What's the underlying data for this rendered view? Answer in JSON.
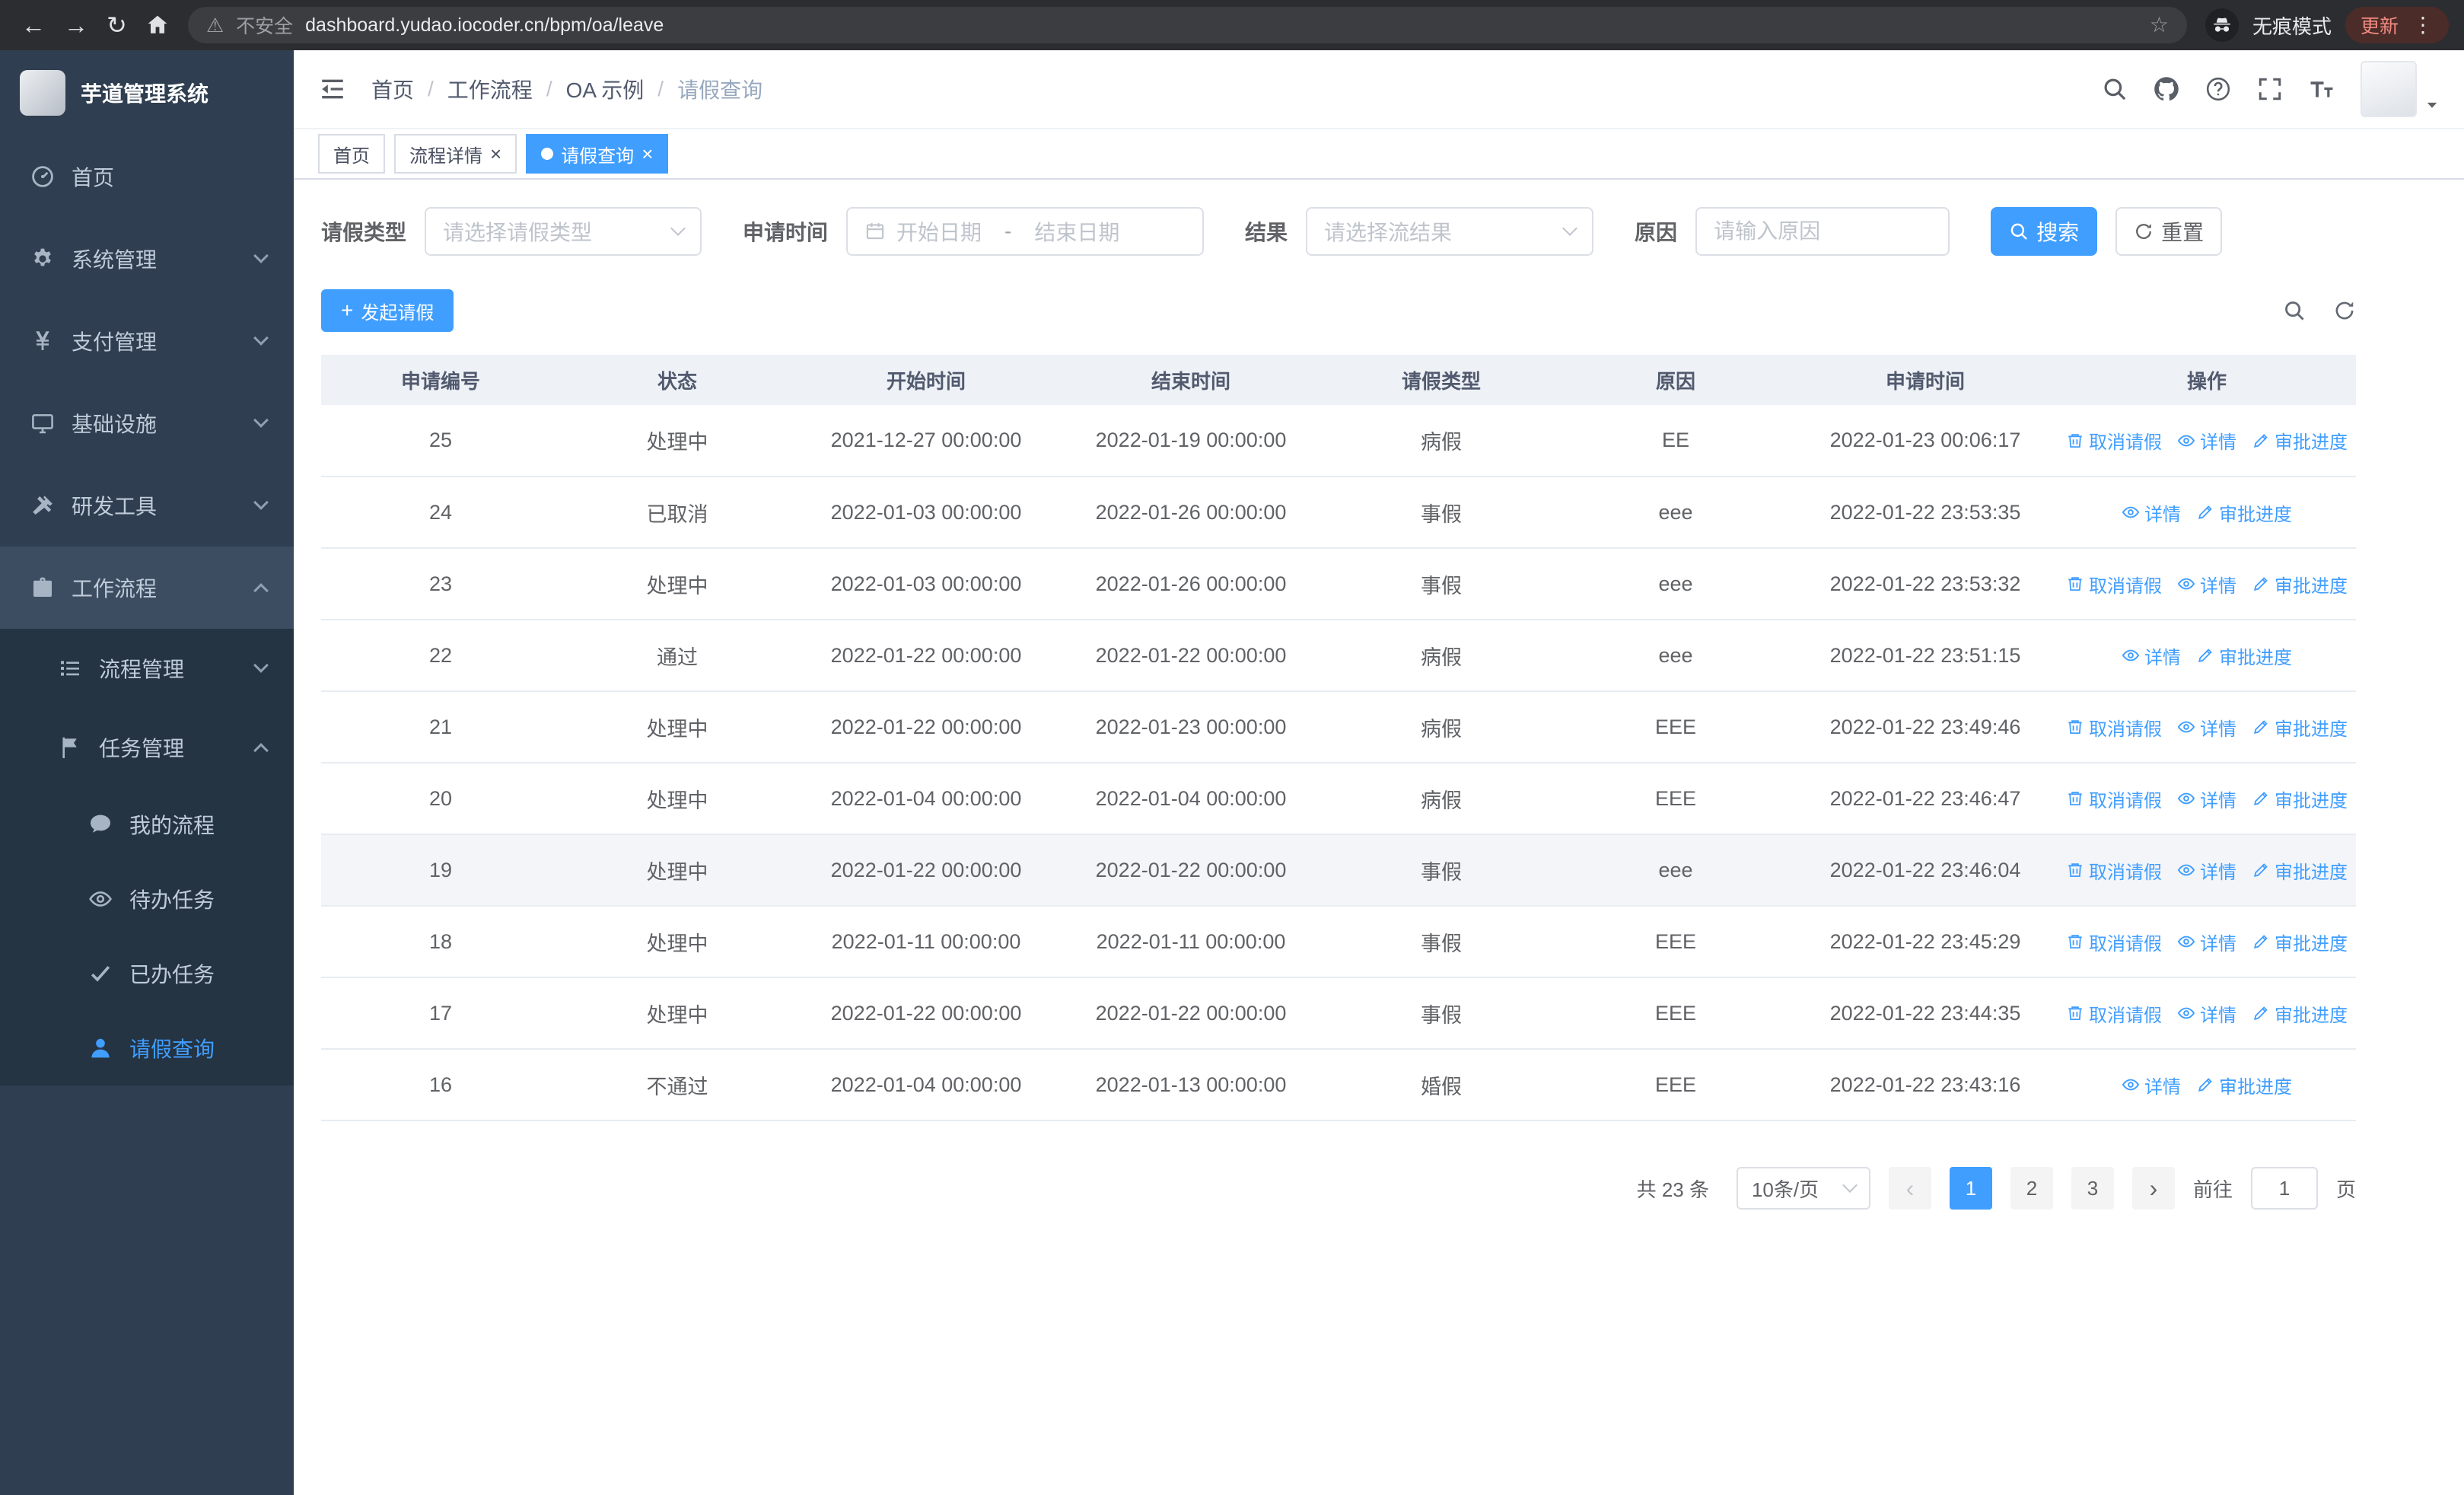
{
  "browser": {
    "url": "dashboard.yudao.iocoder.cn/bpm/oa/leave",
    "security_label": "不安全",
    "incognito_label": "无痕模式",
    "update_label": "更新"
  },
  "sidebar": {
    "title": "芋道管理系统",
    "menu": [
      {
        "key": "home",
        "label": "首页",
        "icon": "dashboard-icon",
        "level": 1
      },
      {
        "key": "system-management",
        "label": "系统管理",
        "icon": "gear-icon",
        "level": 1,
        "chevron": "down"
      },
      {
        "key": "payment-management",
        "label": "支付管理",
        "icon": "payment-icon",
        "level": 1,
        "chevron": "down"
      },
      {
        "key": "infrastructure",
        "label": "基础设施",
        "icon": "infrastructure-icon",
        "level": 1,
        "chevron": "down"
      },
      {
        "key": "devtools",
        "label": "研发工具",
        "icon": "devtools-icon",
        "level": 1,
        "chevron": "down"
      },
      {
        "key": "workflow",
        "label": "工作流程",
        "icon": "workflow-icon",
        "level": 1,
        "chevron": "up",
        "highlight": true
      },
      {
        "key": "process-management",
        "label": "流程管理",
        "icon": "process-icon",
        "level": 2,
        "chevron": "down",
        "sub": true
      },
      {
        "key": "task-management",
        "label": "任务管理",
        "icon": "task-icon",
        "level": 2,
        "chevron": "up",
        "sub": true
      },
      {
        "key": "my-processes",
        "label": "我的流程",
        "icon": "chat-icon",
        "level": 3,
        "sub": true
      },
      {
        "key": "todo-tasks",
        "label": "待办任务",
        "icon": "eye-icon",
        "level": 3,
        "sub": true
      },
      {
        "key": "done-tasks",
        "label": "已办任务",
        "icon": "check-icon",
        "level": 3,
        "sub": true
      },
      {
        "key": "leave-query",
        "label": "请假查询",
        "icon": "user-icon",
        "level": 3,
        "sub": true,
        "active": true
      }
    ]
  },
  "header": {
    "breadcrumb": [
      "首页",
      "工作流程",
      "OA 示例",
      "请假查询"
    ]
  },
  "tabs": [
    {
      "key": "home",
      "label": "首页"
    },
    {
      "key": "process-detail",
      "label": "流程详情",
      "closable": true
    },
    {
      "key": "leave-query",
      "label": "请假查询",
      "closable": true,
      "active": true
    }
  ],
  "filters": {
    "leave_type_label": "请假类型",
    "leave_type_placeholder": "请选择请假类型",
    "apply_time_label": "申请时间",
    "start_date_placeholder": "开始日期",
    "range_separator": "-",
    "end_date_placeholder": "结束日期",
    "result_label": "结果",
    "result_placeholder": "请选择流结果",
    "reason_label": "原因",
    "reason_placeholder": "请输入原因",
    "search_button": "搜索",
    "reset_button": "重置"
  },
  "toolbar": {
    "create_button": "发起请假"
  },
  "table": {
    "columns": [
      "申请编号",
      "状态",
      "开始时间",
      "结束时间",
      "请假类型",
      "原因",
      "申请时间",
      "操作"
    ],
    "action_labels": {
      "cancel": "取消请假",
      "detail": "详情",
      "progress": "审批进度"
    },
    "rows": [
      {
        "id": "25",
        "status": "处理中",
        "start": "2021-12-27 00:00:00",
        "end": "2022-01-19 00:00:00",
        "type": "病假",
        "reason": "EE",
        "applied": "2022-01-23 00:06:17",
        "actions": [
          "cancel",
          "detail",
          "progress"
        ]
      },
      {
        "id": "24",
        "status": "已取消",
        "start": "2022-01-03 00:00:00",
        "end": "2022-01-26 00:00:00",
        "type": "事假",
        "reason": "eee",
        "applied": "2022-01-22 23:53:35",
        "actions": [
          "detail",
          "progress"
        ]
      },
      {
        "id": "23",
        "status": "处理中",
        "start": "2022-01-03 00:00:00",
        "end": "2022-01-26 00:00:00",
        "type": "事假",
        "reason": "eee",
        "applied": "2022-01-22 23:53:32",
        "actions": [
          "cancel",
          "detail",
          "progress"
        ]
      },
      {
        "id": "22",
        "status": "通过",
        "start": "2022-01-22 00:00:00",
        "end": "2022-01-22 00:00:00",
        "type": "病假",
        "reason": "eee",
        "applied": "2022-01-22 23:51:15",
        "actions": [
          "detail",
          "progress"
        ]
      },
      {
        "id": "21",
        "status": "处理中",
        "start": "2022-01-22 00:00:00",
        "end": "2022-01-23 00:00:00",
        "type": "病假",
        "reason": "EEE",
        "applied": "2022-01-22 23:49:46",
        "actions": [
          "cancel",
          "detail",
          "progress"
        ]
      },
      {
        "id": "20",
        "status": "处理中",
        "start": "2022-01-04 00:00:00",
        "end": "2022-01-04 00:00:00",
        "type": "病假",
        "reason": "EEE",
        "applied": "2022-01-22 23:46:47",
        "actions": [
          "cancel",
          "detail",
          "progress"
        ]
      },
      {
        "id": "19",
        "status": "处理中",
        "start": "2022-01-22 00:00:00",
        "end": "2022-01-22 00:00:00",
        "type": "事假",
        "reason": "eee",
        "applied": "2022-01-22 23:46:04",
        "actions": [
          "cancel",
          "detail",
          "progress"
        ],
        "hover": true
      },
      {
        "id": "18",
        "status": "处理中",
        "start": "2022-01-11 00:00:00",
        "end": "2022-01-11 00:00:00",
        "type": "事假",
        "reason": "EEE",
        "applied": "2022-01-22 23:45:29",
        "actions": [
          "cancel",
          "detail",
          "progress"
        ]
      },
      {
        "id": "17",
        "status": "处理中",
        "start": "2022-01-22 00:00:00",
        "end": "2022-01-22 00:00:00",
        "type": "事假",
        "reason": "EEE",
        "applied": "2022-01-22 23:44:35",
        "actions": [
          "cancel",
          "detail",
          "progress"
        ]
      },
      {
        "id": "16",
        "status": "不通过",
        "start": "2022-01-04 00:00:00",
        "end": "2022-01-13 00:00:00",
        "type": "婚假",
        "reason": "EEE",
        "applied": "2022-01-22 23:43:16",
        "actions": [
          "detail",
          "progress"
        ]
      }
    ]
  },
  "pagination": {
    "total": "共 23 条",
    "page_size": "10条/页",
    "pages": [
      "1",
      "2",
      "3"
    ],
    "current": "1",
    "goto_label": "前往",
    "goto_value": "1",
    "unit_label": "页"
  }
}
